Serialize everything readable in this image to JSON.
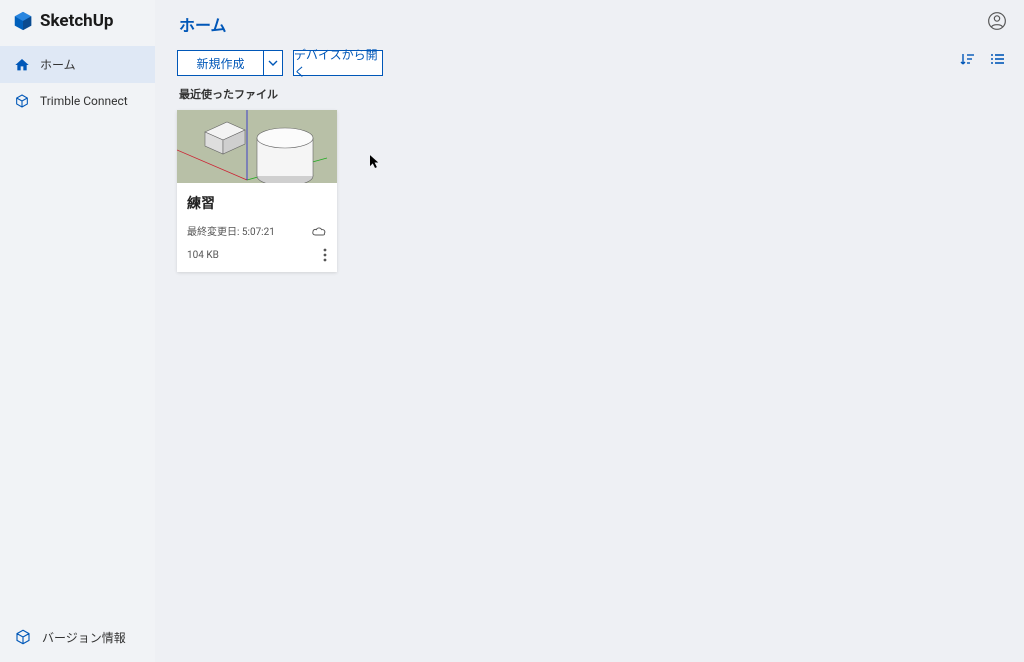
{
  "brand": "SketchUp",
  "page_title": "ホーム",
  "sidebar": {
    "items": [
      {
        "label": "ホーム"
      },
      {
        "label": "Trimble Connect"
      }
    ],
    "footer_label": "バージョン情報"
  },
  "toolbar": {
    "new_label": "新規作成",
    "open_label": "デバイスから開く"
  },
  "recent": {
    "section_label": "最近使ったファイル",
    "files": [
      {
        "title": "練習",
        "modified_label": "最終変更日: 5:07:21",
        "size": "104 KB"
      }
    ]
  }
}
